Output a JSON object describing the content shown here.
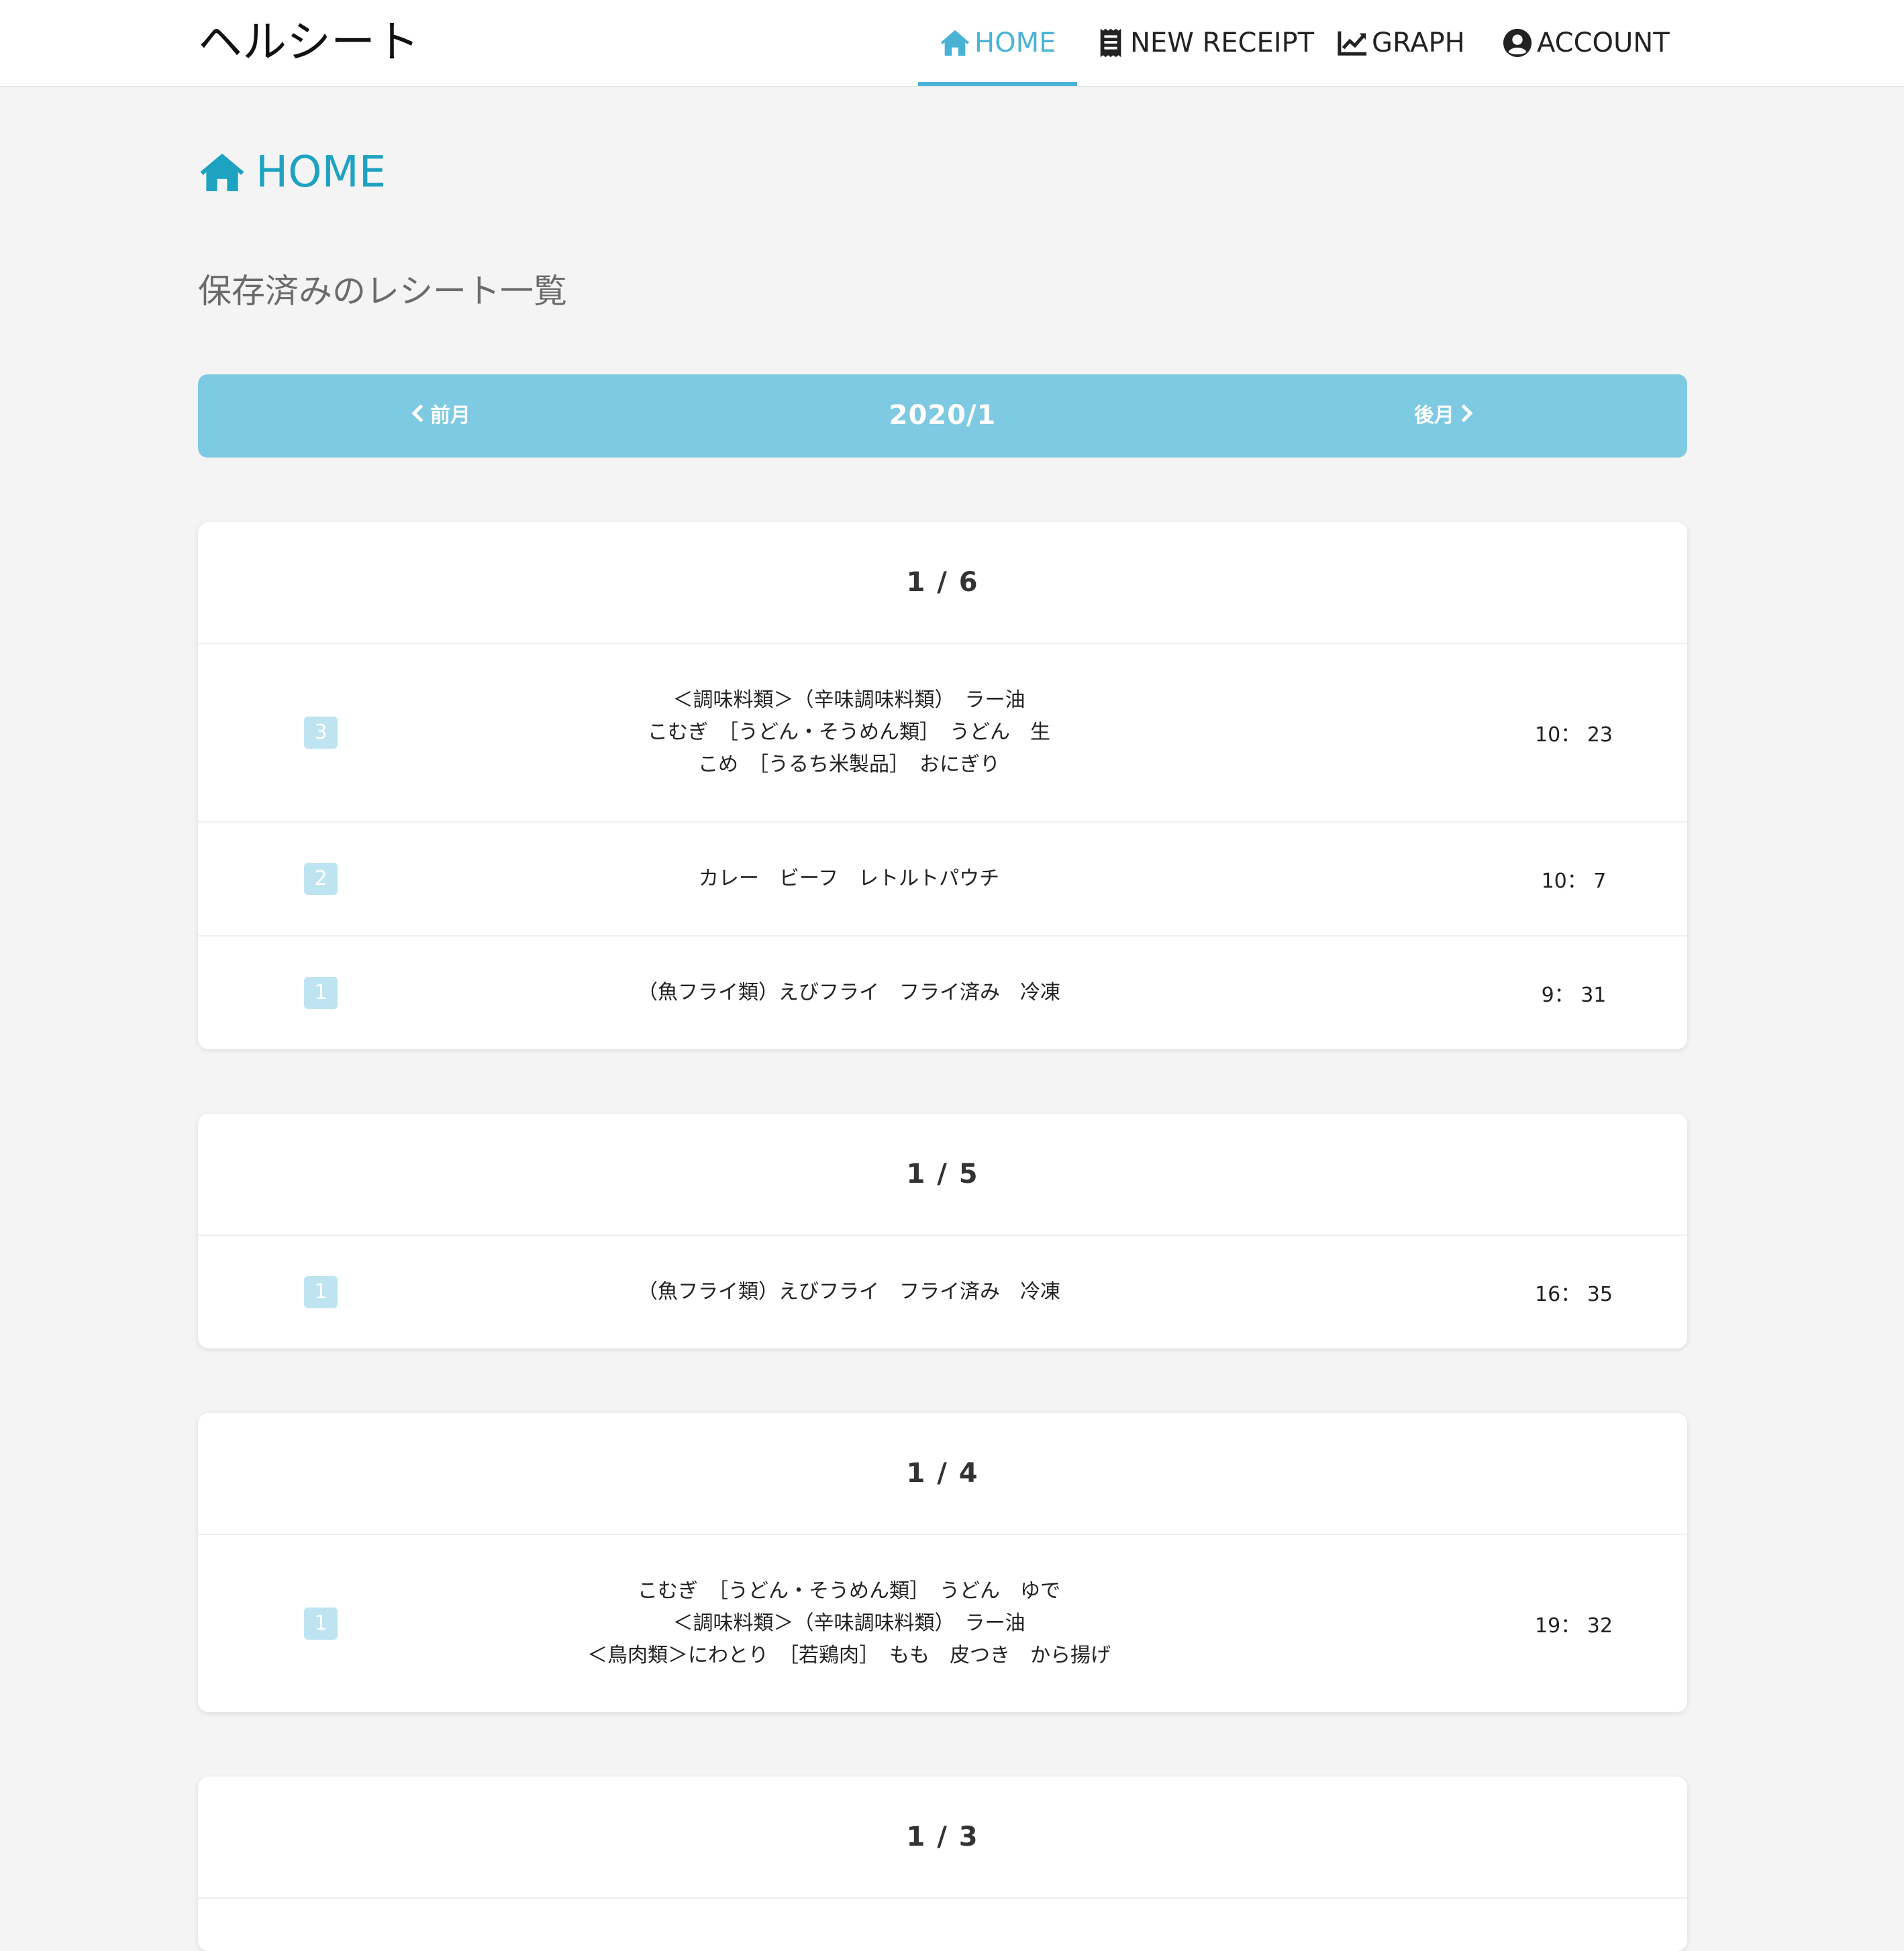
{
  "app": {
    "title": "ヘルシート"
  },
  "nav": {
    "items": [
      {
        "label": "HOME",
        "icon": "home-icon",
        "active": true
      },
      {
        "label": "NEW RECEIPT",
        "icon": "receipt-icon",
        "active": false
      },
      {
        "label": "GRAPH",
        "icon": "chart-line-icon",
        "active": false
      },
      {
        "label": "ACCOUNT",
        "icon": "user-circle-icon",
        "active": false
      }
    ]
  },
  "page": {
    "title": "HOME",
    "subtitle": "保存済みのレシート一覧"
  },
  "month_nav": {
    "prev_label": "前月",
    "current": "2020/1",
    "next_label": "後月"
  },
  "days": [
    {
      "date": "1 / 6",
      "receipts": [
        {
          "count": "3",
          "items": [
            "＜調味料類＞（辛味調味料類）　ラー油",
            "こむぎ　［うどん・そうめん類］　うどん　生",
            "こめ　［うるち米製品］　おにぎり"
          ],
          "time": "10： 23"
        },
        {
          "count": "2",
          "items": [
            "カレー　ビーフ　レトルトパウチ"
          ],
          "time": "10： 7"
        },
        {
          "count": "1",
          "items": [
            "（魚フライ類）えびフライ　フライ済み　冷凍"
          ],
          "time": "9： 31"
        }
      ]
    },
    {
      "date": "1 / 5",
      "receipts": [
        {
          "count": "1",
          "items": [
            "（魚フライ類）えびフライ　フライ済み　冷凍"
          ],
          "time": "16： 35"
        }
      ]
    },
    {
      "date": "1 / 4",
      "receipts": [
        {
          "count": "1",
          "items": [
            "こむぎ　［うどん・そうめん類］　うどん　ゆで",
            "＜調味料類＞（辛味調味料類）　ラー油",
            "＜鳥肉類＞にわとり　［若鶏肉］　もも　皮つき　から揚げ"
          ],
          "time": "19： 32"
        }
      ]
    },
    {
      "date": "1 / 3",
      "receipts": []
    }
  ],
  "colors": {
    "accent": "#4ab3d5",
    "title": "#1ea2c2",
    "month_bar": "#7ecae2",
    "badge": "#bfe4f1"
  }
}
